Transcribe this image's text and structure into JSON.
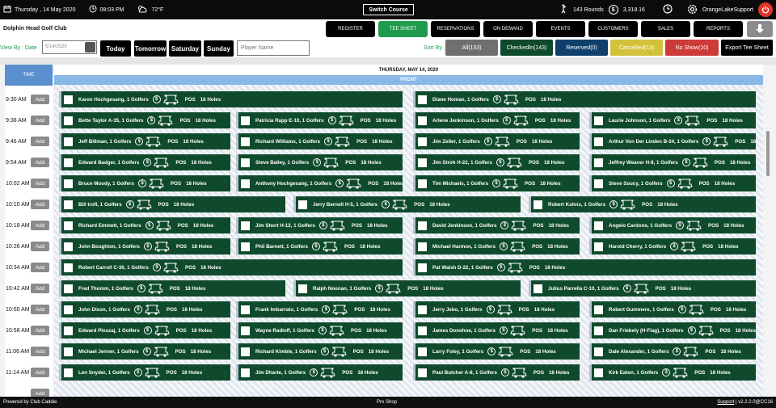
{
  "topbar": {
    "date": "Thursday , 14 May 2020",
    "time": "08:03 PM",
    "weather": "72°F",
    "switch_course": "Switch Course",
    "rounds": "143 Rounds",
    "revenue": "3,318.16",
    "user": "OrangeLakeSupport"
  },
  "club": {
    "name": "Dolphin Head Golf Club"
  },
  "nav": [
    "REGISTER",
    "TEE SHEET",
    "RESERVATIONS",
    "ON DEMAND",
    "EVENTS",
    "CUSTOMERS",
    "SALES",
    "REPORTS"
  ],
  "filters": {
    "view_by": "View By : Date",
    "date_value": "5/14/2020",
    "days": [
      "Today",
      "Tomorrow",
      "Saturday",
      "Sunday"
    ],
    "player_placeholder": "Player Name",
    "sort_by": "Sort By",
    "sort_buttons": [
      {
        "label": "All(153)",
        "color": "#6f6f6f"
      },
      {
        "label": "CheckedIn(143)",
        "color": "#0f4a2c"
      },
      {
        "label": "Reserved(0)",
        "color": "#0f3f6b"
      },
      {
        "label": "Cancelled(13)",
        "color": "#d3c13c"
      },
      {
        "label": "No Show(10)",
        "color": "#cc3a3a"
      }
    ],
    "export": "Export Tee Sheet"
  },
  "sheet": {
    "time_header": "TIME",
    "date_header": "THURSDAY, MAY 14, 2020",
    "front_header": "FRONT",
    "add_label": "Add",
    "pos_label": "POS",
    "holes_label": "18 Holes",
    "rows": [
      {
        "time": "9:30 AM",
        "slots": [
          "Karen Hochgesang, 1 Golfers",
          "Diane Homan, 1 Golfers"
        ]
      },
      {
        "time": "9:38 AM",
        "slots": [
          "Bette Taylor A-35, 1 Golfers",
          "Patricia Rapp E-10, 1 Golfers",
          "Arlene Jenkinson, 1 Golfers",
          "Laurie Johnson, 1 Golfers"
        ]
      },
      {
        "time": "9:46 AM",
        "slots": [
          "Jeff Billman, 1 Golfers",
          "Richard Williams, 1 Golfers",
          "Jim Zeller, 1 Golfers",
          "Arthur Von Der Linden B-34, 1 Golfers"
        ]
      },
      {
        "time": "9:54 AM",
        "slots": [
          "Edward Badger, 1 Golfers",
          "Steve Bailey, 1 Golfers",
          "Jim Stroh H-22, 1 Golfers",
          "Jeffrey Weaver H-8, 1 Golfers"
        ]
      },
      {
        "time": "10:02 AM",
        "slots": [
          "Bruce Moody, 1 Golfers",
          "Anthony Hochgesang, 1 Golfers",
          "Tim Michaels, 1 Golfers",
          "Steve Soucy, 1 Golfers"
        ]
      },
      {
        "time": "10:10 AM",
        "slots": [
          "Bill trofi, 1 Golfers",
          "Jerry Bernelt H-5, 1 Golfers",
          "Robert Kuhns, 1 Golfers"
        ]
      },
      {
        "time": "10:18 AM",
        "slots": [
          "Richard Emmett, 1 Golfers",
          "Jim Short H-12, 1 Golfers",
          "David Jenkinson, 1 Golfers",
          "Angelo Cardone, 1 Golfers"
        ]
      },
      {
        "time": "10:26 AM",
        "slots": [
          "John Boughton, 1 Golfers",
          "Phil Barnett, 1 Golfers",
          "Michael Harmon, 1 Golfers",
          "Harold Cherry, 1 Golfers"
        ]
      },
      {
        "time": "10:34 AM",
        "slots": [
          "Robert Carroll C-36, 1 Golfers",
          "Pat Walsh D-22, 1 Golfers"
        ]
      },
      {
        "time": "10:42 AM",
        "slots": [
          "Fred Thumm, 1 Golfers",
          "Ralph Noonan, 1 Golfers",
          "Julius Parrella C-10, 1 Golfers"
        ]
      },
      {
        "time": "10:50 AM",
        "slots": [
          "John Dixon, 1 Golfers",
          "Frank Imbarrato, 1 Golfers",
          "Jerry Jebo, 1 Golfers",
          "Robert Gummere, 1 Golfers"
        ]
      },
      {
        "time": "10:58 AM",
        "slots": [
          "Edward Ploszaj, 1 Golfers",
          "Wayne Radloff, 1 Golfers",
          "James Donohoe, 1 Golfers",
          "Dan Friebely (H-Flag), 1 Golfers"
        ]
      },
      {
        "time": "11:06 AM",
        "slots": [
          "Michael Jenner, 1 Golfers",
          "Richard Kimble, 1 Golfers",
          "Larry Foley, 1 Golfers",
          "Dale Alexander, 1 Golfers"
        ]
      },
      {
        "time": "11:14 AM",
        "slots": [
          "Len Snyder, 1 Golfers",
          "Jim Dharte, 1 Golfers",
          "Paul Butcher A-8, 1 Golfers",
          "Kirk Eaton, 1 Golfers"
        ]
      }
    ]
  },
  "footer": {
    "powered": "Powered by Club Caddie",
    "center": "Pro Shop",
    "support": "Support",
    "version": "| v2.2.2.0@CC16"
  }
}
